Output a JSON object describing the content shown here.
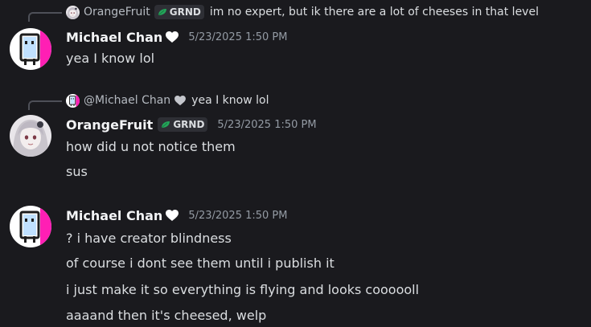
{
  "colors": {
    "background": "#1a1a1e",
    "text": "#dbdee1",
    "muted": "#949ba4",
    "tag_leaf": "#23a55a"
  },
  "messages": [
    {
      "reply": {
        "author": "OrangeFruit",
        "tag": "GRND",
        "text": "im no expert, but ik there are a lot of cheeses in that level"
      },
      "author": "Michael Chan",
      "badge_icon": "white-heart-icon",
      "timestamp": "5/23/2025 1:50 PM",
      "lines": [
        "yea I know lol"
      ]
    },
    {
      "reply": {
        "author": "@Michael Chan",
        "badge_icon": "white-heart-icon",
        "text": "yea I know lol"
      },
      "author": "OrangeFruit",
      "tag": "GRND",
      "timestamp": "5/23/2025 1:50 PM",
      "lines": [
        "how did u not notice them",
        "sus"
      ]
    },
    {
      "author": "Michael Chan",
      "badge_icon": "white-heart-icon",
      "timestamp": "5/23/2025 1:50 PM",
      "lines": [
        "? i have creator blindness",
        "of course i dont see them until i publish it",
        "i just make it so everything is flying and looks coooooll",
        "aaaand then it's cheesed, welp"
      ]
    }
  ]
}
